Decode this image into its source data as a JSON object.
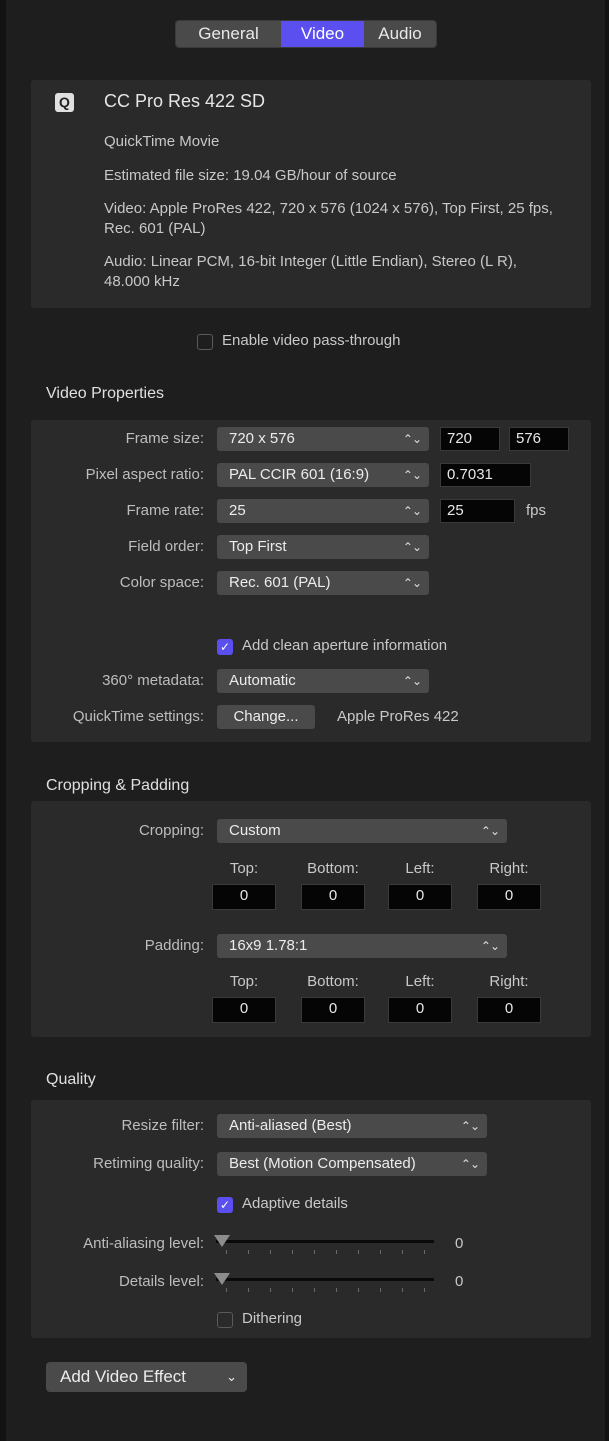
{
  "tabs": [
    {
      "label": "General",
      "active": false
    },
    {
      "label": "Video",
      "active": true
    },
    {
      "label": "Audio",
      "active": false
    }
  ],
  "colors": {
    "accent": "#5b4ff0",
    "panel": "#2a2a2a",
    "background": "#1e1e1e"
  },
  "preset": {
    "icon": "Q",
    "name": "CC Pro Res 422 SD",
    "container": "QuickTime Movie",
    "file_size": "Estimated file size: 19.04 GB/hour of source",
    "video": "Video: Apple ProRes 422, 720 x 576 (1024 x 576), Top First, 25 fps, Rec. 601 (PAL)",
    "audio": "Audio: Linear PCM, 16-bit Integer (Little Endian), Stereo (L R), 48.000 kHz"
  },
  "passthrough": {
    "label": "Enable video pass-through",
    "checked": false
  },
  "video_properties": {
    "heading": "Video Properties",
    "frame_size": {
      "label": "Frame size:",
      "value": "720 x 576",
      "width": "720",
      "height": "576"
    },
    "pixel_aspect": {
      "label": "Pixel aspect ratio:",
      "value": "PAL CCIR 601 (16:9)",
      "ratio": "0.7031"
    },
    "frame_rate": {
      "label": "Frame rate:",
      "value": "25",
      "field": "25",
      "unit": "fps"
    },
    "field_order": {
      "label": "Field order:",
      "value": "Top First"
    },
    "color_space": {
      "label": "Color space:",
      "value": "Rec. 601 (PAL)"
    },
    "clean_aperture": {
      "label": "Add clean aperture information",
      "checked": true
    },
    "metadata_360": {
      "label": "360° metadata:",
      "value": "Automatic"
    },
    "quicktime": {
      "label": "QuickTime settings:",
      "button": "Change...",
      "value": "Apple ProRes 422"
    }
  },
  "cropping_padding": {
    "heading": "Cropping & Padding",
    "cropping": {
      "label": "Cropping:",
      "value": "Custom"
    },
    "padding": {
      "label": "Padding:",
      "value": "16x9 1.78:1"
    },
    "columns": [
      "Top:",
      "Bottom:",
      "Left:",
      "Right:"
    ],
    "crop_values": [
      "0",
      "0",
      "0",
      "0"
    ],
    "pad_values": [
      "0",
      "0",
      "0",
      "0"
    ]
  },
  "quality": {
    "heading": "Quality",
    "resize_filter": {
      "label": "Resize filter:",
      "value": "Anti-aliased (Best)"
    },
    "retiming": {
      "label": "Retiming quality:",
      "value": "Best (Motion Compensated)"
    },
    "adaptive": {
      "label": "Adaptive details",
      "checked": true
    },
    "antialias": {
      "label": "Anti-aliasing level:",
      "value": "0"
    },
    "details": {
      "label": "Details level:",
      "value": "0"
    },
    "dithering": {
      "label": "Dithering",
      "checked": false
    }
  },
  "add_effect": {
    "label": "Add Video Effect"
  },
  "icons": {
    "popup": "up-down-chevron-icon",
    "check": "checkmark-icon",
    "dropdown": "chevron-down-icon",
    "slider": "slider-knob-icon"
  }
}
